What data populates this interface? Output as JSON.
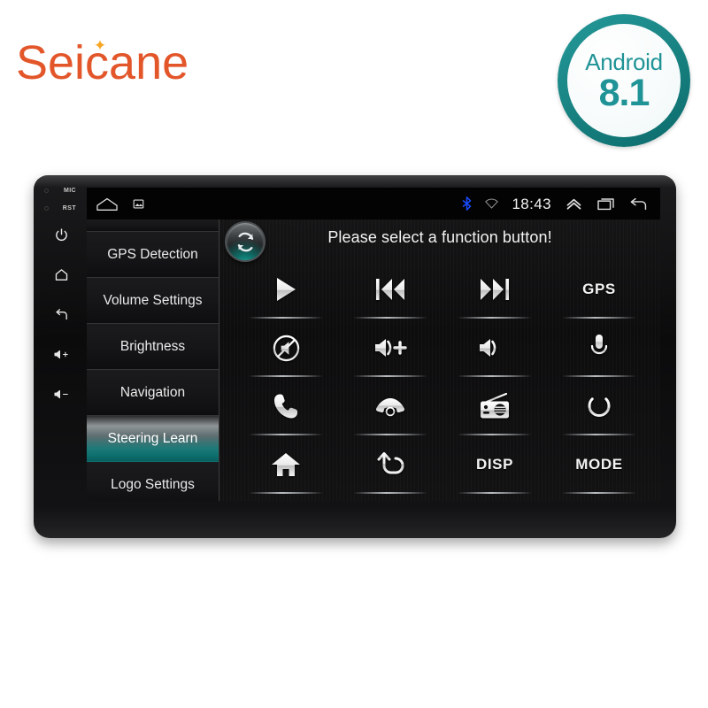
{
  "brand": {
    "name": "Seicane",
    "spark_icon": "sparkle-icon",
    "color": "#e2562a"
  },
  "badge": {
    "os_label": "Android",
    "version": "8.1",
    "ring_color": "#17807f",
    "text_color": "#1f9396"
  },
  "device": {
    "hardware_labels": [
      {
        "text": "MIC",
        "name": "mic-pinhole-label"
      },
      {
        "text": "RST",
        "name": "reset-pinhole-label"
      }
    ],
    "hardware_buttons": [
      {
        "icon": "power-icon",
        "name": "hw-power-button"
      },
      {
        "icon": "home-icon",
        "name": "hw-home-button"
      },
      {
        "icon": "back-icon",
        "name": "hw-back-button"
      },
      {
        "icon": "volume-up-icon",
        "name": "hw-volume-up-button",
        "glyph": "⌣+"
      },
      {
        "icon": "volume-down-icon",
        "name": "hw-volume-down-button",
        "glyph": "⌣-"
      }
    ]
  },
  "statusbar": {
    "left_icons": [
      {
        "icon": "home-outline-icon",
        "name": "status-home-icon"
      },
      {
        "icon": "screenshot-icon",
        "name": "status-screenshot-icon"
      }
    ],
    "bluetooth_icon": "bluetooth-icon",
    "bluetooth_color": "#1a4bff",
    "wifi_icon": "wifi-icon",
    "wifi_color": "#8d8d8d",
    "clock": "18:43",
    "right_icons": [
      {
        "icon": "chevron-up-icon",
        "name": "status-expand-icon"
      },
      {
        "icon": "recent-apps-icon",
        "name": "status-recents-icon"
      },
      {
        "icon": "back-arrow-icon",
        "name": "status-back-icon"
      }
    ]
  },
  "sidebar": {
    "items": [
      {
        "label": "",
        "selected": false,
        "partial": true
      },
      {
        "label": "GPS Detection",
        "selected": false
      },
      {
        "label": "Volume Settings",
        "selected": false
      },
      {
        "label": "Brightness",
        "selected": false
      },
      {
        "label": "Navigation",
        "selected": false
      },
      {
        "label": "Steering Learn",
        "selected": true
      },
      {
        "label": "Logo Settings",
        "selected": false
      }
    ],
    "selected_label": "Steering Learn",
    "highlight_color": "#0c6f6e"
  },
  "main": {
    "prompt": "Please select a function button!",
    "sync_button": {
      "icon": "sync-refresh-icon",
      "name": "sync-button"
    },
    "buttons": [
      {
        "name": "play-button",
        "icon": "play-icon",
        "label": ""
      },
      {
        "name": "previous-button",
        "icon": "previous-track-icon",
        "label": ""
      },
      {
        "name": "next-button",
        "icon": "next-track-icon",
        "label": ""
      },
      {
        "name": "gps-button",
        "icon": "text-icon",
        "label": "GPS"
      },
      {
        "name": "mute-button",
        "icon": "mute-icon",
        "label": ""
      },
      {
        "name": "volume-up-button",
        "icon": "volume-up-icon",
        "label": ""
      },
      {
        "name": "volume-down-button",
        "icon": "volume-down-icon",
        "label": ""
      },
      {
        "name": "microphone-button",
        "icon": "microphone-icon",
        "label": ""
      },
      {
        "name": "call-answer-button",
        "icon": "phone-icon",
        "label": ""
      },
      {
        "name": "call-hangup-button",
        "icon": "hang-up-icon",
        "label": ""
      },
      {
        "name": "radio-button",
        "icon": "radio-icon",
        "label": ""
      },
      {
        "name": "power-button",
        "icon": "power-icon",
        "label": ""
      },
      {
        "name": "home-button",
        "icon": "home-filled-icon",
        "label": ""
      },
      {
        "name": "back-button",
        "icon": "back-arrow-icon",
        "label": ""
      },
      {
        "name": "disp-button",
        "icon": "text-icon",
        "label": "DISP"
      },
      {
        "name": "mode-button",
        "icon": "text-icon",
        "label": "MODE"
      }
    ]
  }
}
